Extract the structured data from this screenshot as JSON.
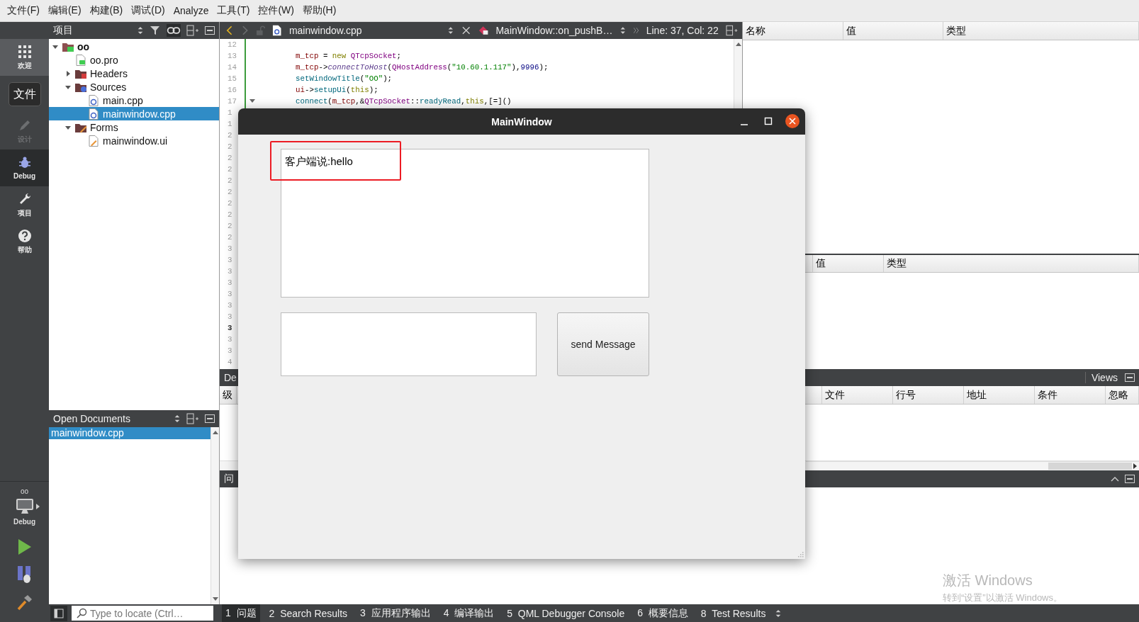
{
  "menu_bar": [
    "文件(F)",
    "编辑(E)",
    "构建(B)",
    "调试(D)",
    "Analyze",
    "工具(T)",
    "控件(W)",
    "帮助(H)"
  ],
  "mode_bar": {
    "modes": [
      {
        "kind": "welcome",
        "label": "欢迎",
        "selected": false,
        "highlighted": true,
        "disabled": false
      },
      {
        "kind": "design",
        "label": "设计",
        "selected": false,
        "highlighted": false,
        "disabled": true
      },
      {
        "kind": "debug",
        "label": "Debug",
        "selected": true,
        "highlighted": false,
        "disabled": false
      },
      {
        "kind": "projects",
        "label": "项目",
        "selected": false,
        "highlighted": false,
        "disabled": false
      },
      {
        "kind": "help",
        "label": "帮助",
        "selected": false,
        "highlighted": false,
        "disabled": false
      }
    ],
    "tooltip": "文件",
    "run_target": {
      "project": "oo",
      "build": "Debug"
    }
  },
  "projects_pane": {
    "title": "项目",
    "tree": [
      {
        "label": "oo",
        "kind": "project",
        "expanded": true,
        "selected": false,
        "children": [
          {
            "label": "oo.pro",
            "kind": "pro",
            "selected": false
          },
          {
            "label": "Headers",
            "kind": "headers",
            "expanded": false,
            "selected": false
          },
          {
            "label": "Sources",
            "kind": "sources",
            "expanded": true,
            "selected": false,
            "children": [
              {
                "label": "main.cpp",
                "kind": "cpp",
                "selected": false
              },
              {
                "label": "mainwindow.cpp",
                "kind": "cpp",
                "selected": true
              }
            ]
          },
          {
            "label": "Forms",
            "kind": "forms",
            "expanded": true,
            "selected": false,
            "children": [
              {
                "label": "mainwindow.ui",
                "kind": "ui",
                "selected": false
              }
            ]
          }
        ]
      }
    ]
  },
  "open_documents": {
    "title": "Open Documents",
    "items": [
      {
        "label": "mainwindow.cpp",
        "selected": true
      }
    ]
  },
  "locator": {
    "placeholder": "Type to locate (Ctrl…"
  },
  "editor": {
    "file": "mainwindow.cpp",
    "symbol": "MainWindow::on_pushB…",
    "position": "Line: 37, Col: 22",
    "back_enabled": true,
    "forward_enabled": false,
    "lines": [
      {
        "number": "12",
        "current": false
      },
      {
        "number": "13",
        "current": false,
        "tokens": [
          {
            "kind": "field",
            "text": "m_tcp"
          },
          {
            "kind": "plain",
            "text": " = "
          },
          {
            "kind": "keyword",
            "text": "new"
          },
          {
            "kind": "type",
            "text": " QTcpSocket"
          },
          {
            "kind": "plain",
            "text": ";"
          }
        ]
      },
      {
        "number": "14",
        "current": false,
        "tokens": [
          {
            "kind": "field",
            "text": "m_tcp"
          },
          {
            "kind": "plain",
            "text": "->"
          },
          {
            "kind": "virtual",
            "text": "connectToHost"
          },
          {
            "kind": "plain",
            "text": "("
          },
          {
            "kind": "type",
            "text": "QHostAddress"
          },
          {
            "kind": "plain",
            "text": "("
          },
          {
            "kind": "string",
            "text": "\"10.60.1.117\""
          },
          {
            "kind": "plain",
            "text": "),"
          },
          {
            "kind": "number",
            "text": "9996"
          },
          {
            "kind": "plain",
            "text": ");"
          }
        ]
      },
      {
        "number": "15",
        "current": false,
        "tokens": [
          {
            "kind": "func",
            "text": "setWindowTitle"
          },
          {
            "kind": "plain",
            "text": "("
          },
          {
            "kind": "string",
            "text": "\"OO\""
          },
          {
            "kind": "plain",
            "text": ");"
          }
        ]
      },
      {
        "number": "16",
        "current": false,
        "tokens": [
          {
            "kind": "field",
            "text": "ui"
          },
          {
            "kind": "plain",
            "text": "->"
          },
          {
            "kind": "func",
            "text": "setupUi"
          },
          {
            "kind": "plain",
            "text": "("
          },
          {
            "kind": "keyword",
            "text": "this"
          },
          {
            "kind": "plain",
            "text": ");"
          }
        ]
      },
      {
        "number": "17",
        "current": false,
        "foldable": true,
        "tokens": [
          {
            "kind": "func",
            "text": "connect"
          },
          {
            "kind": "plain",
            "text": "("
          },
          {
            "kind": "field",
            "text": "m_tcp"
          },
          {
            "kind": "plain",
            "text": ",&"
          },
          {
            "kind": "type",
            "text": "QTcpSocket"
          },
          {
            "kind": "plain",
            "text": "::"
          },
          {
            "kind": "func",
            "text": "readyRead"
          },
          {
            "kind": "plain",
            "text": ","
          },
          {
            "kind": "keyword",
            "text": "this"
          },
          {
            "kind": "plain",
            "text": ",[=]()"
          }
        ]
      },
      {
        "number": "1",
        "current": false
      },
      {
        "number": "1",
        "current": false
      },
      {
        "number": "2",
        "current": false
      },
      {
        "number": "2",
        "current": false
      },
      {
        "number": "2",
        "current": false
      },
      {
        "number": "2",
        "current": false
      },
      {
        "number": "2",
        "current": false
      },
      {
        "number": "2",
        "current": false
      },
      {
        "number": "2",
        "current": false
      },
      {
        "number": "2",
        "current": false
      },
      {
        "number": "2",
        "current": false
      },
      {
        "number": "2",
        "current": false
      },
      {
        "number": "3",
        "current": false
      },
      {
        "number": "3",
        "current": false
      },
      {
        "number": "3",
        "current": false
      },
      {
        "number": "3",
        "current": false
      },
      {
        "number": "3",
        "current": false
      },
      {
        "number": "3",
        "current": false
      },
      {
        "number": "3",
        "current": false
      },
      {
        "number": "3",
        "current": true
      },
      {
        "number": "3",
        "current": false
      },
      {
        "number": "3",
        "current": false
      },
      {
        "number": "4",
        "current": false
      }
    ]
  },
  "locals": {
    "columns": [
      "名称",
      "值",
      "类型"
    ]
  },
  "watchers": {
    "columns": [
      "值",
      "类型"
    ]
  },
  "debugger_panel": {
    "title": "De",
    "views_label": "Views",
    "columns": [
      "级",
      "文件",
      "行号",
      "地址",
      "条件",
      "忽略"
    ]
  },
  "issues_panel": {
    "title": "问"
  },
  "output_tabs": [
    {
      "number": "1",
      "label": "问题",
      "selected": true
    },
    {
      "number": "2",
      "label": "Search Results",
      "selected": false
    },
    {
      "number": "3",
      "label": "应用程序输出",
      "selected": false
    },
    {
      "number": "4",
      "label": "编译输出",
      "selected": false
    },
    {
      "number": "5",
      "label": "QML Debugger Console",
      "selected": false
    },
    {
      "number": "6",
      "label": "概要信息",
      "selected": false
    },
    {
      "number": "8",
      "label": "Test Results",
      "selected": false
    }
  ],
  "app_window": {
    "title": "MainWindow",
    "message_log": "客户端说:hello",
    "send_button": "send Message"
  },
  "os_notice": {
    "title": "激活 Windows",
    "subtitle": "转到“设置”以激活 Windows。"
  }
}
